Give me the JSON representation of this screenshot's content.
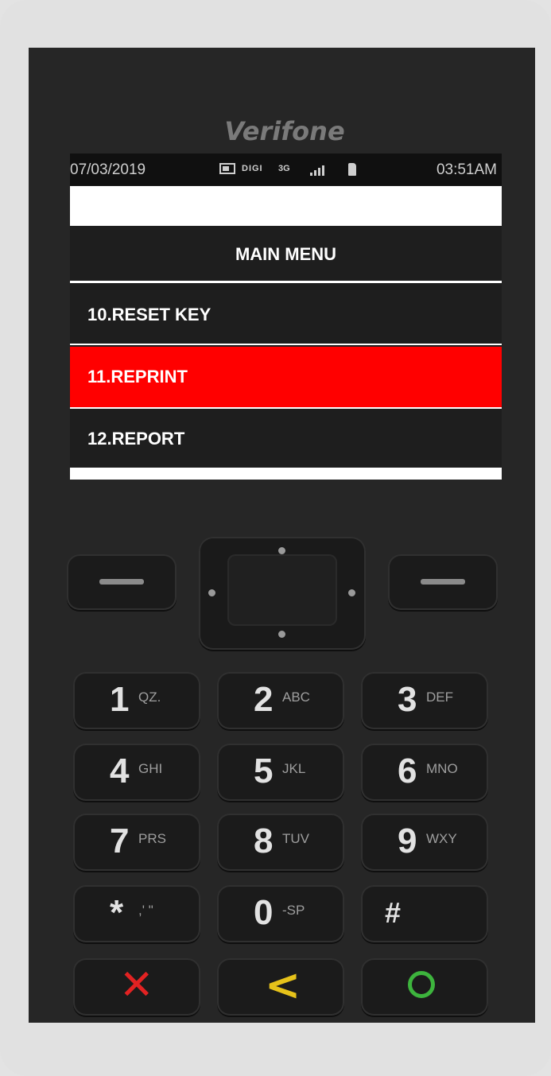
{
  "device": {
    "brand": "Verifone"
  },
  "status_bar": {
    "date": "07/03/2019",
    "carrier": "DIGI",
    "network": "3G",
    "time": "03:51AM"
  },
  "menu": {
    "title": "MAIN MENU",
    "items": [
      {
        "label": "10.RESET KEY",
        "selected": false
      },
      {
        "label": "11.REPRINT",
        "selected": true
      },
      {
        "label": "12.REPORT",
        "selected": false
      }
    ],
    "highlight_color": "#ff0000"
  },
  "keypad": {
    "keys": [
      {
        "digit": "1",
        "letters": "QZ."
      },
      {
        "digit": "2",
        "letters": "ABC"
      },
      {
        "digit": "3",
        "letters": "DEF"
      },
      {
        "digit": "4",
        "letters": "GHI"
      },
      {
        "digit": "5",
        "letters": "JKL"
      },
      {
        "digit": "6",
        "letters": "MNO"
      },
      {
        "digit": "7",
        "letters": "PRS"
      },
      {
        "digit": "8",
        "letters": "TUV"
      },
      {
        "digit": "9",
        "letters": "WXY"
      },
      {
        "digit": "*",
        "letters": ",' \""
      },
      {
        "digit": "0",
        "letters": "-SP"
      },
      {
        "digit": "#",
        "letters": ""
      }
    ],
    "function_keys": {
      "cancel": "✕",
      "back": "<",
      "enter_icon": "circle-icon"
    },
    "colors": {
      "cancel": "#e22222",
      "back": "#e6c21a",
      "enter": "#3db43d"
    }
  }
}
